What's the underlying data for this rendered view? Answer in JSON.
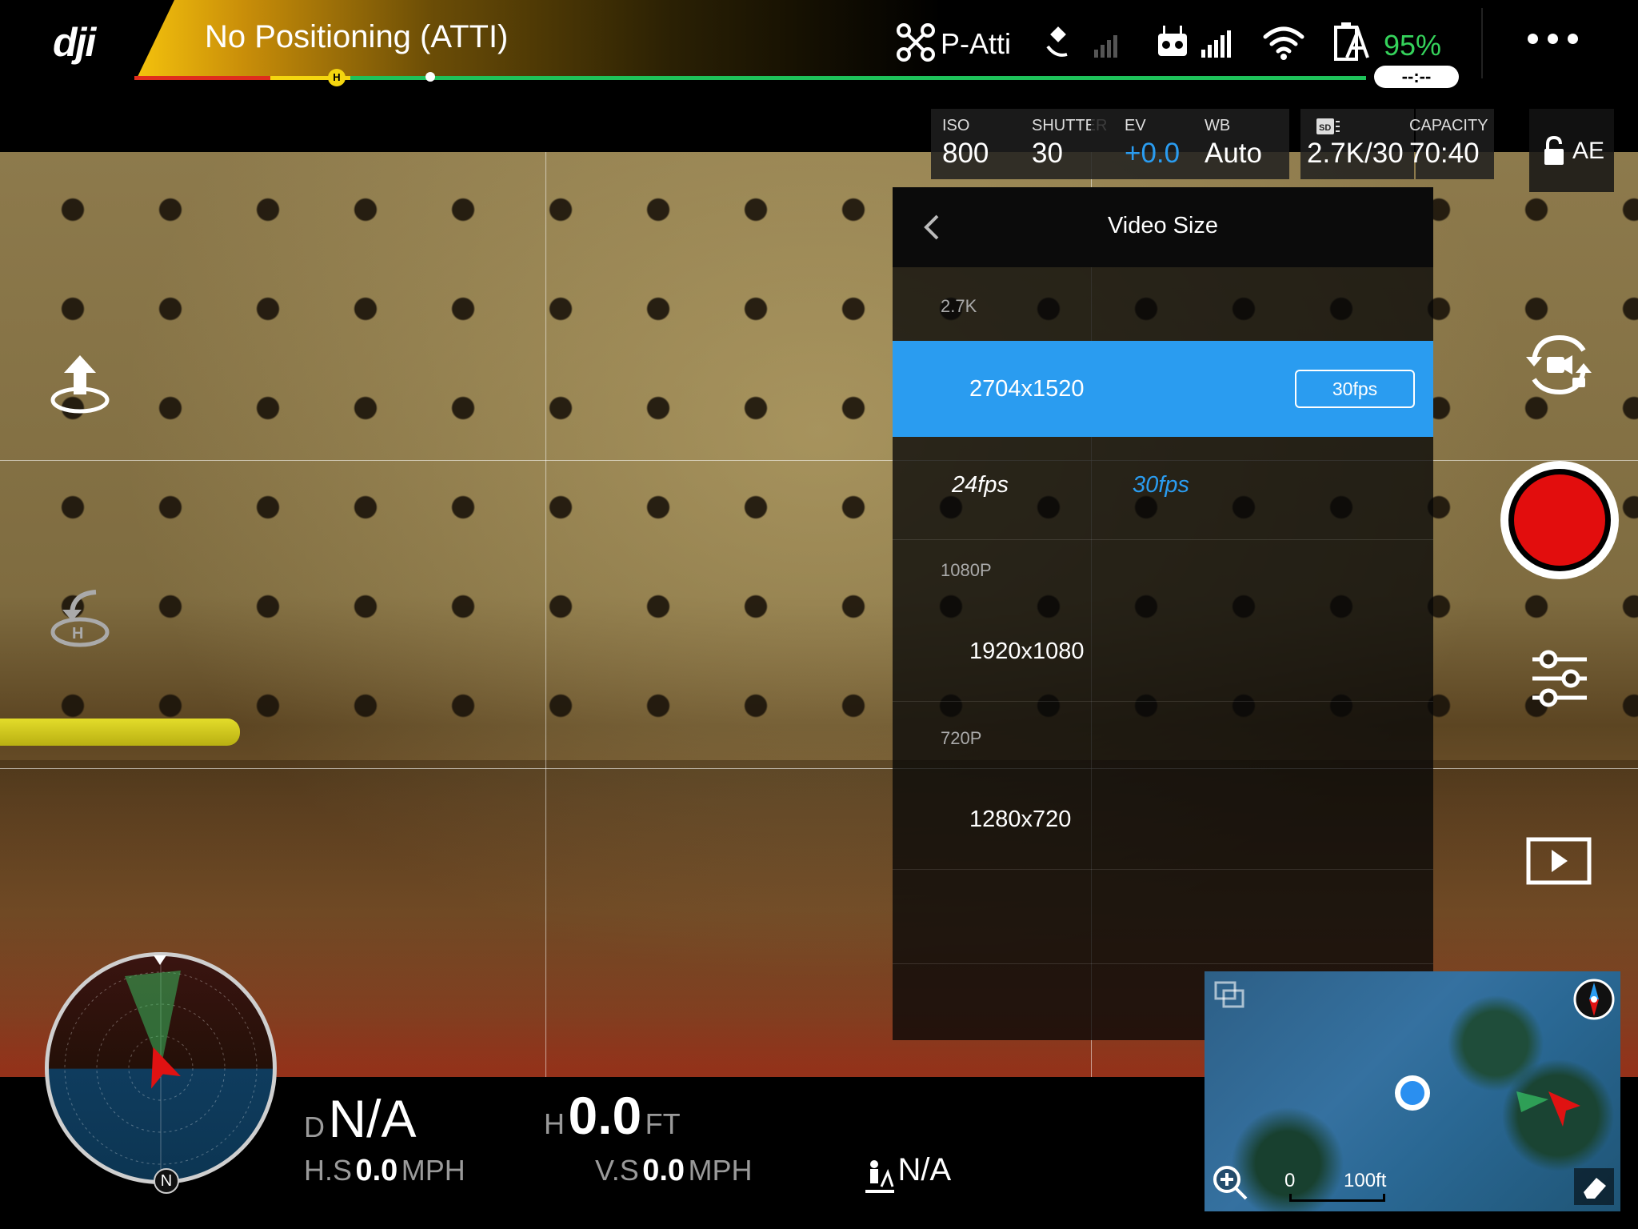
{
  "topbar": {
    "logo": "dji",
    "flight_status": "No Positioning (ATTI)",
    "home_marker": "H",
    "flight_mode": "P-Atti",
    "battery_percent": "95%",
    "flight_time": "--:--"
  },
  "camera_settings": {
    "iso": {
      "label": "ISO",
      "value": "800"
    },
    "shutter": {
      "label": "SHUTTER",
      "value": "30"
    },
    "ev": {
      "label": "EV",
      "value": "+0.0"
    },
    "wb": {
      "label": "WB",
      "value": "Auto"
    },
    "storage": {
      "label": "SD",
      "value": "2.7K/30"
    },
    "capacity": {
      "label": "CAPACITY",
      "value": "70:40"
    },
    "ae_lock": "AE"
  },
  "video_size_panel": {
    "title": "Video Size",
    "sections": [
      {
        "label": "2.7K",
        "resolution": "2704x1520",
        "selected": true,
        "selected_fps": "30fps",
        "fps_options": [
          "24fps",
          "30fps"
        ]
      },
      {
        "label": "1080P",
        "resolution": "1920x1080"
      },
      {
        "label": "720P",
        "resolution": "1280x720"
      }
    ]
  },
  "telemetry": {
    "distance": {
      "label": "D",
      "value": "N/A"
    },
    "height": {
      "label": "H",
      "value": "0.0",
      "unit": "FT"
    },
    "h_speed": {
      "label": "H.S",
      "value": "0.0",
      "unit": "MPH"
    },
    "v_speed": {
      "label": "V.S",
      "value": "0.0",
      "unit": "MPH"
    },
    "vps": {
      "value": "N/A"
    }
  },
  "radar": {
    "north_label": "N"
  },
  "minimap": {
    "scale_start": "0",
    "scale_end": "100ft"
  },
  "colors": {
    "accent": "#2a9cf0",
    "record": "#e20d0d",
    "battery": "#35d35b",
    "status_yellow": "#f4c20d"
  }
}
